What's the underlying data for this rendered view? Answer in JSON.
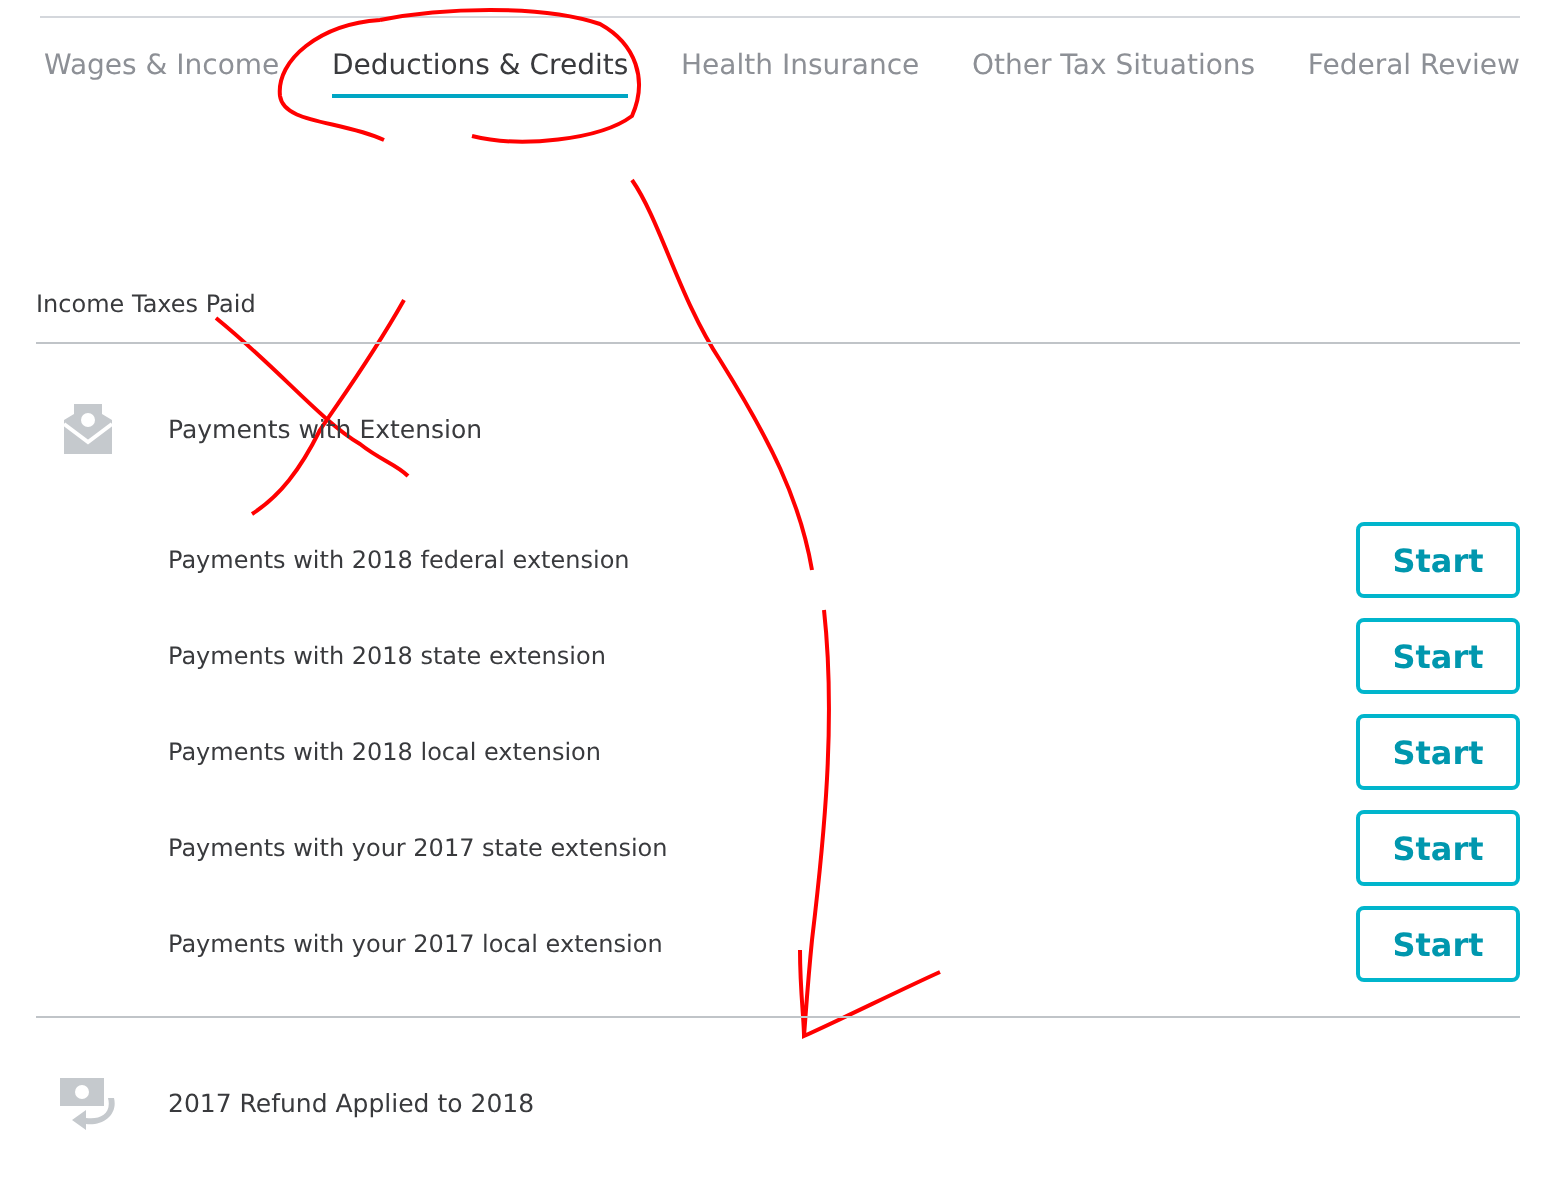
{
  "tabs": [
    {
      "label": "Wages & Income",
      "selected": false
    },
    {
      "label": "Deductions & Credits",
      "selected": true
    },
    {
      "label": "Health Insurance",
      "selected": false
    },
    {
      "label": "Other Tax Situations",
      "selected": false
    },
    {
      "label": "Federal Review",
      "selected": false
    }
  ],
  "section": {
    "title": "Income Taxes Paid",
    "groups": [
      {
        "title": "Payments with Extension",
        "items": [
          {
            "label": "Payments with 2018 federal extension",
            "button": "Start"
          },
          {
            "label": "Payments with 2018 state extension",
            "button": "Start"
          },
          {
            "label": "Payments with 2018 local extension",
            "button": "Start"
          },
          {
            "label": "Payments with your 2017 state extension",
            "button": "Start"
          },
          {
            "label": "Payments with your 2017 local extension",
            "button": "Start"
          }
        ]
      },
      {
        "title": "2017 Refund Applied to 2018"
      }
    ]
  },
  "annotations": [
    {
      "kind": "circle"
    },
    {
      "kind": "cross"
    },
    {
      "kind": "arrow"
    }
  ]
}
